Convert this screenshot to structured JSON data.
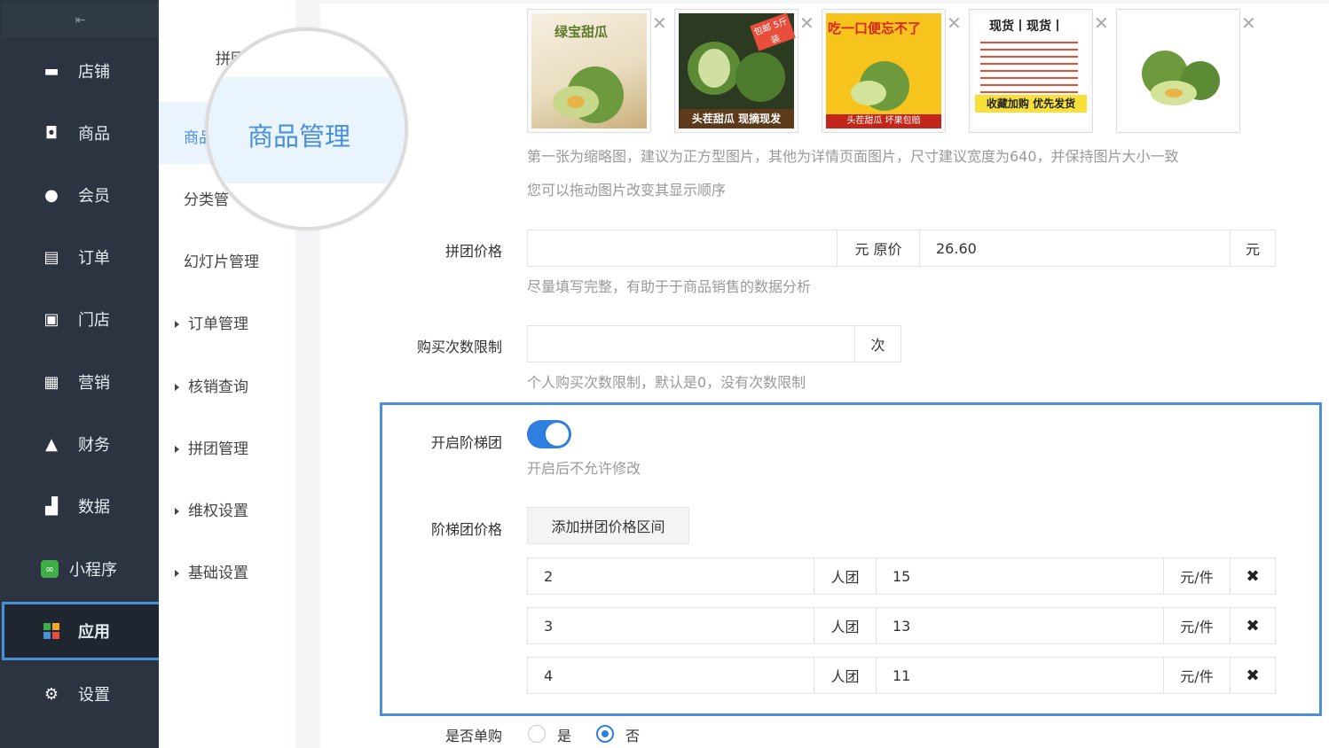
{
  "sidebar": {
    "collapse_icon": "collapse-icon",
    "items": [
      {
        "label": "店铺",
        "icon": "store-icon"
      },
      {
        "label": "商品",
        "icon": "goods-icon"
      },
      {
        "label": "会员",
        "icon": "user-icon"
      },
      {
        "label": "订单",
        "icon": "document-icon"
      },
      {
        "label": "门店",
        "icon": "shop-icon"
      },
      {
        "label": "营销",
        "icon": "gift-icon"
      },
      {
        "label": "财务",
        "icon": "money-bag-icon"
      },
      {
        "label": "数据",
        "icon": "chart-icon"
      },
      {
        "label": "小程序",
        "icon": "miniprogram-icon"
      },
      {
        "label": "应用",
        "icon": "apps-icon",
        "active": true
      },
      {
        "label": "设置",
        "icon": "gear-icon"
      }
    ]
  },
  "subnav": {
    "items": [
      "拼团",
      "商品",
      "分类管",
      "幻灯片管理",
      "订单管理",
      "核销查询",
      "拼团管理",
      "维权设置",
      "基础设置"
    ]
  },
  "magnifier": {
    "text": "商品管理"
  },
  "images": {
    "thumbs": [
      {
        "caption": "绿宝甜瓜",
        "sub": ""
      },
      {
        "caption": "头茬甜瓜 现摘现发",
        "sub": "包邮 5斤装"
      },
      {
        "caption": "吃一口便忘不了",
        "sub": "头茬甜瓜 坏果包赔"
      },
      {
        "caption": "现货丨现货丨",
        "sub": "收藏加购 优先发货"
      },
      {
        "caption": "",
        "sub": ""
      }
    ],
    "help1": "第一张为缩略图，建议为正方型图片，其他为详情页面图片，尺寸建议宽度为640，并保持图片大小一致",
    "help2": "您可以拖动图片改变其显示顺序"
  },
  "price": {
    "label": "拼团价格",
    "value": "",
    "unit_orig": "元 原价",
    "orig_value": "26.60",
    "unit": "元",
    "help": "尽量填写完整，有助于于商品销售的数据分析"
  },
  "limit": {
    "label": "购买次数限制",
    "value": "",
    "unit": "次",
    "help": "个人购买次数限制，默认是0，没有次数限制"
  },
  "ladder": {
    "toggle_label": "开启阶梯团",
    "toggle_on": true,
    "toggle_help": "开启后不允许修改",
    "price_label": "阶梯团价格",
    "add_button": "添加拼团价格区间",
    "rows": [
      {
        "people": "2",
        "people_unit": "人团",
        "price": "15",
        "price_unit": "元/件"
      },
      {
        "people": "3",
        "people_unit": "人团",
        "price": "13",
        "price_unit": "元/件"
      },
      {
        "people": "4",
        "people_unit": "人团",
        "price": "11",
        "price_unit": "元/件"
      }
    ]
  },
  "single": {
    "label": "是否单购",
    "yes": "是",
    "no": "否",
    "selected": "否"
  },
  "colors": {
    "accent": "#2f7fe0",
    "sidebar": "#2b3440",
    "highlight": "#4a90d9"
  }
}
